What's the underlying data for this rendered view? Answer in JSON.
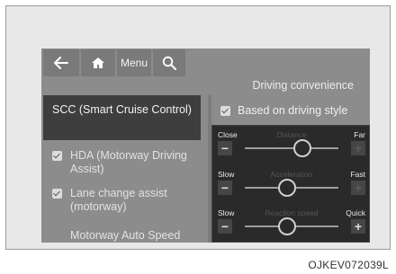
{
  "toolbar": {
    "back_icon": "arrow-left-icon",
    "home_icon": "home-icon",
    "menu_label": "Menu",
    "search_icon": "search-icon"
  },
  "section_title": "Driving convenience",
  "menu": {
    "active_item": "SCC (Smart Cruise Control)",
    "items": [
      "HDA (Motorway Driving Assist)",
      "Lane change assist (motorway)",
      "Motorway Auto Speed"
    ]
  },
  "option": {
    "label": "Based on driving style",
    "checked": true
  },
  "sliders": [
    {
      "left": "Close",
      "center": "Distance",
      "right": "Far",
      "level": 0.62,
      "plus_enabled": false
    },
    {
      "left": "Slow",
      "center": "Acceleration",
      "right": "Fast",
      "level": 0.45,
      "plus_enabled": false
    },
    {
      "left": "Slow",
      "center": "Reaction speed",
      "right": "Quick",
      "level": 0.45,
      "plus_enabled": true
    }
  ],
  "caption": "OJKEV072039L"
}
